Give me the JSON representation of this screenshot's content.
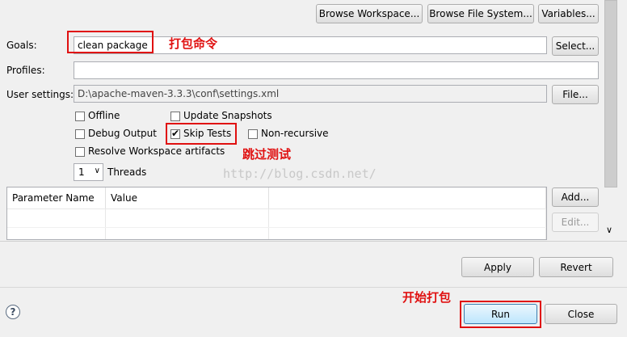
{
  "top_buttons": {
    "browse_workspace": "Browse Workspace...",
    "browse_file_system": "Browse File System...",
    "variables": "Variables..."
  },
  "goals": {
    "label": "Goals:",
    "value": "clean package",
    "select_button": "Select..."
  },
  "profiles": {
    "label": "Profiles:",
    "value": ""
  },
  "user_settings": {
    "label": "User settings:",
    "value": "D:\\apache-maven-3.3.3\\conf\\settings.xml",
    "file_button": "File..."
  },
  "options": {
    "offline": {
      "label": "Offline",
      "checked": false
    },
    "update_snapshots": {
      "label": "Update Snapshots",
      "checked": false
    },
    "debug_output": {
      "label": "Debug Output",
      "checked": false
    },
    "skip_tests": {
      "label": "Skip Tests",
      "checked": true
    },
    "non_recursive": {
      "label": "Non-recursive",
      "checked": false
    },
    "resolve_workspace": {
      "label": "Resolve Workspace artifacts",
      "checked": false
    }
  },
  "threads": {
    "value": "1",
    "label": "Threads"
  },
  "params_table": {
    "columns": [
      "Parameter Name",
      "Value"
    ],
    "add_button": "Add...",
    "edit_button": "Edit..."
  },
  "apply_button": "Apply",
  "revert_button": "Revert",
  "run_button": "Run",
  "close_button": "Close",
  "help_icon": "?",
  "annotations": {
    "goals_note": "打包命令",
    "skip_tests_note": "跳过测试",
    "run_note": "开始打包"
  },
  "watermark": "http://blog.csdn.net/",
  "colors": {
    "annotation": "#e01010"
  }
}
